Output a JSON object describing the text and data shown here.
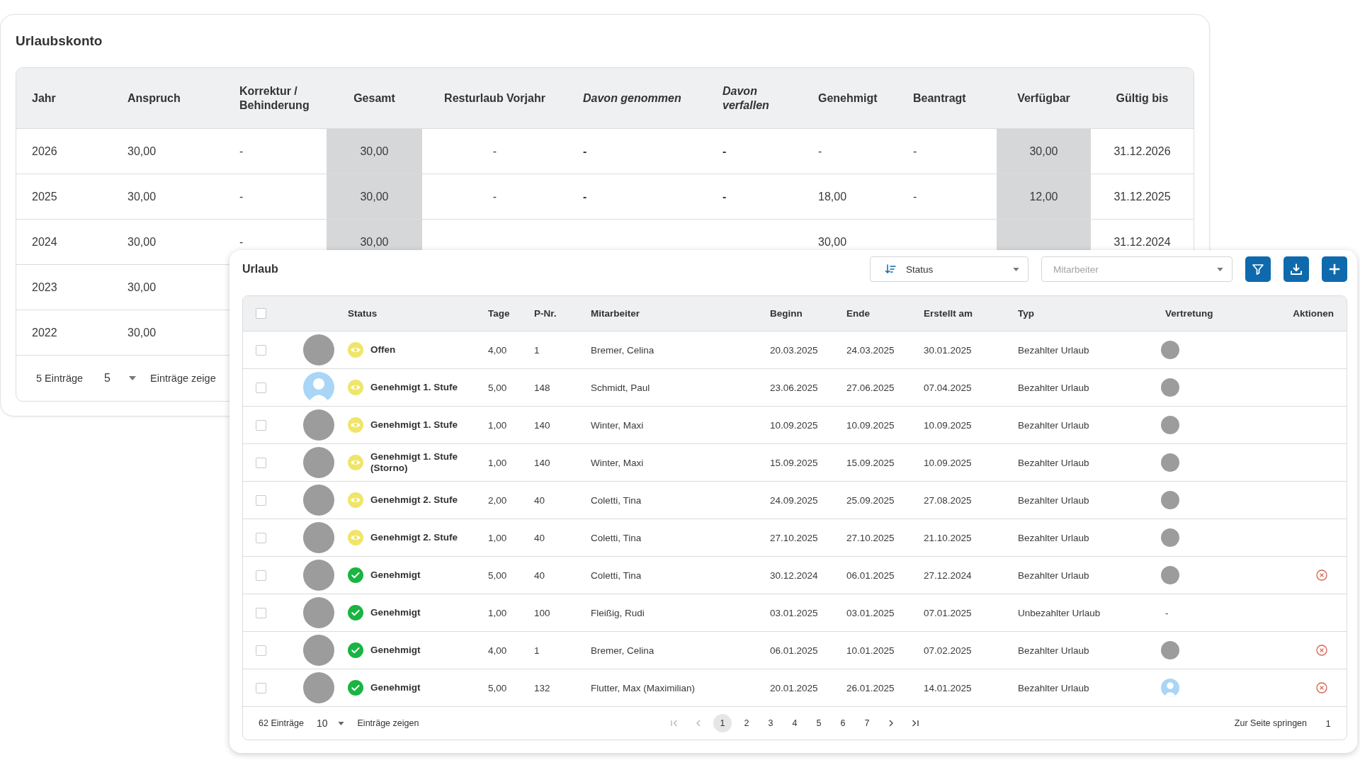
{
  "urlaubskonto": {
    "title": "Urlaubskonto",
    "columns": [
      "Jahr",
      "Anspruch",
      "Korrektur / Behinderung",
      "Gesamt",
      "Resturlaub Vorjahr",
      "Davon genommen",
      "Davon verfallen",
      "Genehmigt",
      "Beantragt",
      "Verfügbar",
      "Gültig bis"
    ],
    "rows": [
      {
        "jahr": "2026",
        "anspruch": "30,00",
        "korrektur": "-",
        "gesamt": "30,00",
        "resturlaub_vorjahr": "-",
        "davon_genommen": "-",
        "davon_verfallen": "-",
        "genehmigt": "-",
        "beantragt": "-",
        "verfuegbar": "30,00",
        "gueltig_bis": "31.12.2026"
      },
      {
        "jahr": "2025",
        "anspruch": "30,00",
        "korrektur": "-",
        "gesamt": "30,00",
        "resturlaub_vorjahr": "-",
        "davon_genommen": "-",
        "davon_verfallen": "-",
        "genehmigt": "18,00",
        "beantragt": "-",
        "verfuegbar": "12,00",
        "gueltig_bis": "31.12.2025"
      },
      {
        "jahr": "2024",
        "anspruch": "30,00",
        "korrektur": "-",
        "gesamt": "30,00",
        "genehmigt": "30,00",
        "gueltig_bis": "31.12.2024"
      },
      {
        "jahr": "2023",
        "anspruch": "30,00"
      },
      {
        "jahr": "2022",
        "anspruch": "30,00"
      }
    ],
    "footer": {
      "count": "5 Einträge",
      "page_size": "5",
      "page_size_label": "Einträge zeige"
    }
  },
  "urlaub": {
    "title": "Urlaub",
    "sort_select": {
      "value": "Status"
    },
    "employee_select": {
      "placeholder": "Mitarbeiter"
    },
    "buttons": [
      {
        "kind": "filter"
      },
      {
        "kind": "download"
      },
      {
        "kind": "add"
      }
    ],
    "table": {
      "select_all": {
        "checked": false
      },
      "columns": [
        "Status",
        "Tage",
        "P-Nr.",
        "Mitarbeiter",
        "Beginn",
        "Ende",
        "Erstellt am",
        "Typ",
        "Vertretung",
        "Aktionen"
      ],
      "rows": [
        {
          "checked": false,
          "avatar": {
            "kind": "photo"
          },
          "status": {
            "kind": "in_review",
            "label": "Offen"
          },
          "tage": "4,00",
          "p_nr": "1",
          "mitarbeiter": "Bremer, Celina",
          "beginn": "20.03.2025",
          "ende": "24.03.2025",
          "erstellt_am": "30.01.2025",
          "typ": "Bezahlter Urlaub",
          "vertretung": {
            "kind": "photo"
          },
          "cancelable": false
        },
        {
          "checked": false,
          "avatar": {
            "kind": "placeholder"
          },
          "status": {
            "kind": "in_review",
            "label": "Genehmigt 1. Stufe"
          },
          "tage": "5,00",
          "p_nr": "148",
          "mitarbeiter": "Schmidt, Paul",
          "beginn": "23.06.2025",
          "ende": "27.06.2025",
          "erstellt_am": "07.04.2025",
          "typ": "Bezahlter Urlaub",
          "vertretung": {
            "kind": "photo"
          },
          "cancelable": false
        },
        {
          "checked": false,
          "avatar": {
            "kind": "photo"
          },
          "status": {
            "kind": "in_review",
            "label": "Genehmigt 1. Stufe"
          },
          "tage": "1,00",
          "p_nr": "140",
          "mitarbeiter": "Winter, Maxi",
          "beginn": "10.09.2025",
          "ende": "10.09.2025",
          "erstellt_am": "10.09.2025",
          "typ": "Bezahlter Urlaub",
          "vertretung": {
            "kind": "photo"
          },
          "cancelable": false
        },
        {
          "checked": false,
          "avatar": {
            "kind": "photo"
          },
          "status": {
            "kind": "in_review",
            "label": "Genehmigt 1. Stufe (Storno)"
          },
          "tage": "1,00",
          "p_nr": "140",
          "mitarbeiter": "Winter, Maxi",
          "beginn": "15.09.2025",
          "ende": "15.09.2025",
          "erstellt_am": "10.09.2025",
          "typ": "Bezahlter Urlaub",
          "vertretung": {
            "kind": "photo"
          },
          "cancelable": false
        },
        {
          "checked": false,
          "avatar": {
            "kind": "photo"
          },
          "status": {
            "kind": "in_review",
            "label": "Genehmigt 2. Stufe"
          },
          "tage": "2,00",
          "p_nr": "40",
          "mitarbeiter": "Coletti, Tina",
          "beginn": "24.09.2025",
          "ende": "25.09.2025",
          "erstellt_am": "27.08.2025",
          "typ": "Bezahlter Urlaub",
          "vertretung": {
            "kind": "photo"
          },
          "cancelable": false
        },
        {
          "checked": false,
          "avatar": {
            "kind": "photo"
          },
          "status": {
            "kind": "in_review",
            "label": "Genehmigt 2. Stufe"
          },
          "tage": "1,00",
          "p_nr": "40",
          "mitarbeiter": "Coletti, Tina",
          "beginn": "27.10.2025",
          "ende": "27.10.2025",
          "erstellt_am": "21.10.2025",
          "typ": "Bezahlter Urlaub",
          "vertretung": {
            "kind": "photo"
          },
          "cancelable": false
        },
        {
          "checked": false,
          "avatar": {
            "kind": "photo"
          },
          "status": {
            "kind": "approved",
            "label": "Genehmigt"
          },
          "tage": "5,00",
          "p_nr": "40",
          "mitarbeiter": "Coletti, Tina",
          "beginn": "30.12.2024",
          "ende": "06.01.2025",
          "erstellt_am": "27.12.2024",
          "typ": "Bezahlter Urlaub",
          "vertretung": {
            "kind": "photo"
          },
          "cancelable": true
        },
        {
          "checked": false,
          "avatar": {
            "kind": "photo"
          },
          "status": {
            "kind": "approved",
            "label": "Genehmigt"
          },
          "tage": "1,00",
          "p_nr": "100",
          "mitarbeiter": "Fleißig, Rudi",
          "beginn": "03.01.2025",
          "ende": "03.01.2025",
          "erstellt_am": "07.01.2025",
          "typ": "Unbezahlter Urlaub",
          "vertretung": {
            "kind": "text",
            "text": "-"
          },
          "cancelable": false
        },
        {
          "checked": false,
          "avatar": {
            "kind": "photo"
          },
          "status": {
            "kind": "approved",
            "label": "Genehmigt"
          },
          "tage": "4,00",
          "p_nr": "1",
          "mitarbeiter": "Bremer, Celina",
          "beginn": "06.01.2025",
          "ende": "10.01.2025",
          "erstellt_am": "07.02.2025",
          "typ": "Bezahlter Urlaub",
          "vertretung": {
            "kind": "photo"
          },
          "cancelable": true
        },
        {
          "checked": false,
          "avatar": {
            "kind": "photo"
          },
          "status": {
            "kind": "approved",
            "label": "Genehmigt"
          },
          "tage": "5,00",
          "p_nr": "132",
          "mitarbeiter": "Flutter, Max (Maximilian)",
          "beginn": "20.01.2025",
          "ende": "26.01.2025",
          "erstellt_am": "14.01.2025",
          "typ": "Bezahlter Urlaub",
          "vertretung": {
            "kind": "placeholder"
          },
          "cancelable": true
        }
      ]
    },
    "footer": {
      "count": "62 Einträge",
      "page_size": "10",
      "page_size_label": "Einträge zeigen",
      "pagination": {
        "first": {
          "disabled": true
        },
        "previous": {
          "disabled": true
        },
        "pages": [
          {
            "label": "1",
            "selected": true
          },
          {
            "label": "2",
            "selected": false
          },
          {
            "label": "3",
            "selected": false
          },
          {
            "label": "4",
            "selected": false
          },
          {
            "label": "5",
            "selected": false
          },
          {
            "label": "6",
            "selected": false
          },
          {
            "label": "7",
            "selected": false
          }
        ],
        "next": {
          "disabled": false
        },
        "last": {
          "disabled": false
        }
      },
      "jump_label": "Zur Seite springen",
      "jump_value": "1"
    }
  }
}
